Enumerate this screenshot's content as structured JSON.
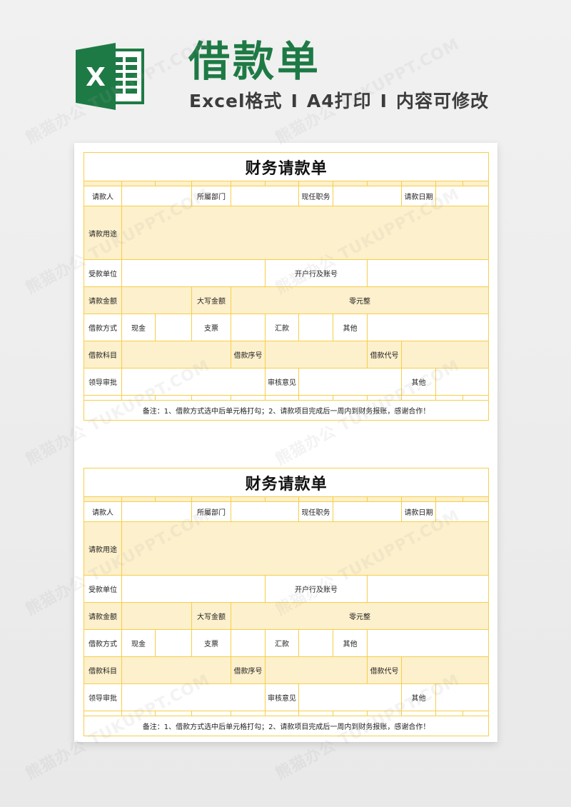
{
  "header": {
    "icon": "excel-icon",
    "icon_letter": "X",
    "title": "借款单",
    "subtitle_parts": [
      "Excel格式",
      "I",
      "A4打印",
      "I",
      "内容可修改"
    ],
    "brand_color": "#1e7a45"
  },
  "colors": {
    "border": "#f6cf48",
    "fill": "#fdf0cc",
    "paper": "#ffffff",
    "background": "#efefef"
  },
  "watermark": "熊猫办公 TUKUPPT.COM",
  "forms": [
    {
      "title": "财务请款单",
      "row1": {
        "applicant": "请款人",
        "department": "所屬部门",
        "position": "现任职务",
        "date": "请款日期"
      },
      "row2": {
        "purpose": "请款用途"
      },
      "row3": {
        "payee": "受款单位",
        "bank_account": "开户行及账号"
      },
      "row4": {
        "amount": "请款金额",
        "amount_upper": "大写金额",
        "amount_upper_value": "零元整"
      },
      "row5": {
        "method": "借款方式",
        "cash": "现金",
        "check": "支票",
        "remit": "汇款",
        "other": "其他"
      },
      "row6": {
        "subject": "借款科目",
        "serial": "借款序号",
        "code": "借款代号"
      },
      "row7": {
        "leader_approval": "领导审批",
        "audit_opinion": "审核意见",
        "other": "其他"
      },
      "note": "备注：1、借款方式选中后单元格打勾；2、请款项目完成后一周内到财务报账，感谢合作！"
    },
    {
      "title": "财务请款单",
      "row1": {
        "applicant": "请款人",
        "department": "所屬部门",
        "position": "现任职务",
        "date": "请款日期"
      },
      "row2": {
        "purpose": "请款用途"
      },
      "row3": {
        "payee": "受款单位",
        "bank_account": "开户行及账号"
      },
      "row4": {
        "amount": "请款金额",
        "amount_upper": "大写金额",
        "amount_upper_value": "零元整"
      },
      "row5": {
        "method": "借款方式",
        "cash": "现金",
        "check": "支票",
        "remit": "汇款",
        "other": "其他"
      },
      "row6": {
        "subject": "借款科目",
        "serial": "借款序号",
        "code": "借款代号"
      },
      "row7": {
        "leader_approval": "领导审批",
        "audit_opinion": "审核意见",
        "other": "其他"
      },
      "note": "备注：1、借款方式选中后单元格打勾；2、请款项目完成后一周内到财务报账，感谢合作！"
    }
  ]
}
